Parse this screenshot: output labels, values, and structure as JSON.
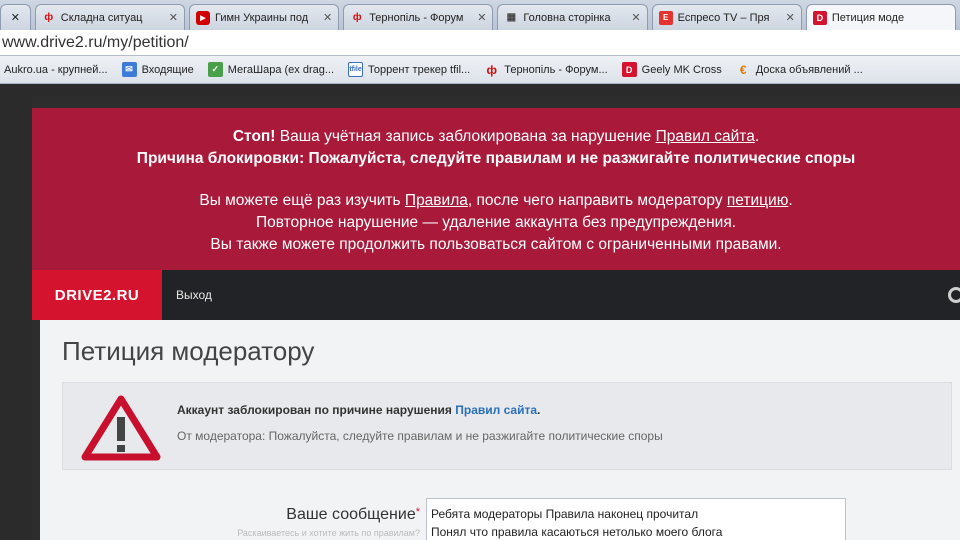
{
  "browser": {
    "tabs": [
      {
        "label": "✕",
        "icon": "close-icon"
      },
      {
        "label": "Складна ситуац",
        "icon": "tern-forum-icon"
      },
      {
        "label": "Гимн Украины под",
        "icon": "youtube-icon"
      },
      {
        "label": "Тернопіль - Форум",
        "icon": "tern-forum-icon"
      },
      {
        "label": "Головна сторінка",
        "icon": "grid-icon"
      },
      {
        "label": "Еспресо TV – Пря",
        "icon": "espreso-icon"
      },
      {
        "label": "Петиция моде",
        "icon": "drive2-icon"
      }
    ],
    "url": "www.drive2.ru/my/petition/",
    "bookmarks": [
      {
        "label": "Aukro.ua - крупней...",
        "icon": ""
      },
      {
        "label": "Входящие",
        "icon": "mail-icon"
      },
      {
        "label": "МегаШара (ex drag...",
        "icon": "megashara-icon"
      },
      {
        "label": "Торрент трекер tfil...",
        "icon": "tfile-icon"
      },
      {
        "label": "Тернопіль - Форум...",
        "icon": "tern-forum-icon"
      },
      {
        "label": "Geely MK Cross",
        "icon": "drive2-icon"
      },
      {
        "label": "Доска объявлений ...",
        "icon": "doska-icon"
      }
    ]
  },
  "banner": {
    "line1_bold": "Стоп!",
    "line1_text": " Ваша учётная запись заблокирована за нарушение ",
    "line1_link": "Правил сайта",
    "line1_end": ".",
    "line2": "Причина блокировки: Пожалуйста, следуйте правилам и не разжигайте политические споры",
    "line3_text": "Вы можете ещё раз изучить ",
    "line3_link1": "Правила",
    "line3_mid": ", после чего направить модератору ",
    "line3_link2": "петицию",
    "line3_end": ".",
    "line4": "Повторное нарушение — удаление аккаунта без предупреждения.",
    "line5": "Вы также можете продолжить пользоваться сайтом с ограниченными правами."
  },
  "nav": {
    "logo": "DRIVE2.RU",
    "logout": "Выход"
  },
  "page": {
    "title": "Петиция модератору",
    "alert_text": "Аккаунт заблокирован по причине нарушения ",
    "alert_link": "Правил сайта",
    "alert_end": ".",
    "alert_reason": "От модератора: Пожалуйста, следуйте правилам и не разжигайте политические споры",
    "message_label": "Ваше сообщение",
    "message_required": "*",
    "message_hint": "Раскаиваетесь и хотите жить по правилам?",
    "message_value": "Ребята модераторы Правила наконец прочитал\nПонял что правила касаються нетолько моего блога"
  },
  "colors": {
    "banner": "#a8193a",
    "brand": "#d4142e",
    "link": "#2a6fb8",
    "warning_icon": "#c8102e"
  }
}
